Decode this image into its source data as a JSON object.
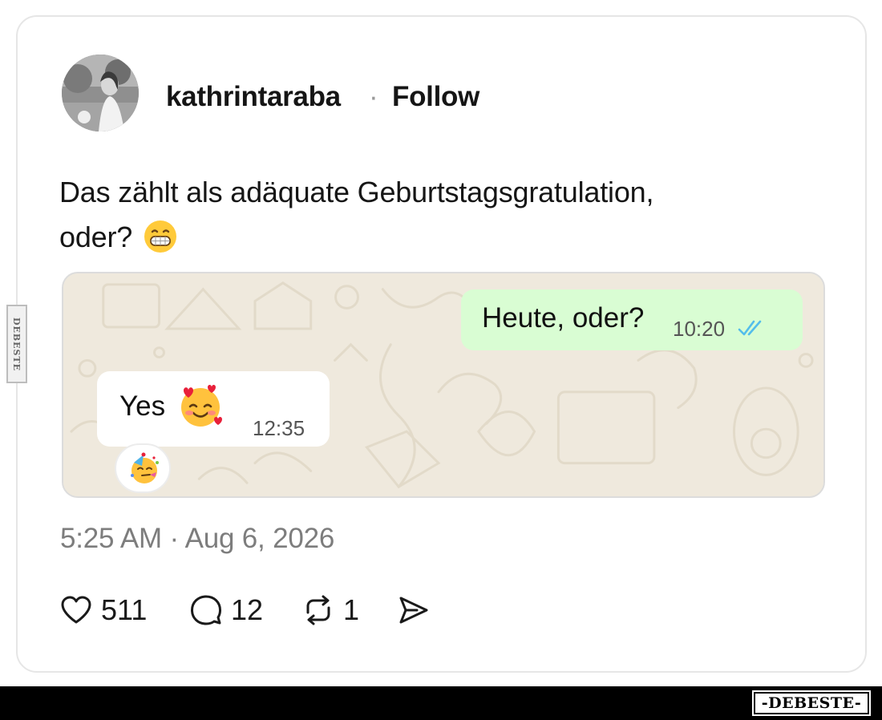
{
  "watermark": {
    "side_text": "DEBESTE",
    "bottom_text": "-DEBESTE-"
  },
  "post": {
    "username": "kathrintaraba",
    "separator": "·",
    "follow_label": "Follow",
    "text_line1": "Das zählt als adäquate Geburtstagsgratulation,",
    "text_line2": "oder?",
    "text_emoji_icon": "grinning-face-with-teeth-icon",
    "timestamp": "5:25 AM · Aug 6, 2026"
  },
  "chat": {
    "background_color": "#efe9dd",
    "outgoing": {
      "text": "Heute, oder?",
      "time": "10:20",
      "status_icon": "double-check-icon",
      "bubble_color": "#d9fdd3",
      "tick_color": "#53bdeb"
    },
    "incoming": {
      "text": "Yes",
      "emoji_icon": "smiling-face-with-hearts-icon",
      "time": "12:35",
      "bubble_color": "#ffffff"
    },
    "reaction_icon": "partying-face-icon"
  },
  "actions": [
    {
      "icon": "heart-icon",
      "count": "511"
    },
    {
      "icon": "comment-icon",
      "count": "12"
    },
    {
      "icon": "repost-icon",
      "count": "1"
    },
    {
      "icon": "share-icon",
      "count": ""
    }
  ]
}
